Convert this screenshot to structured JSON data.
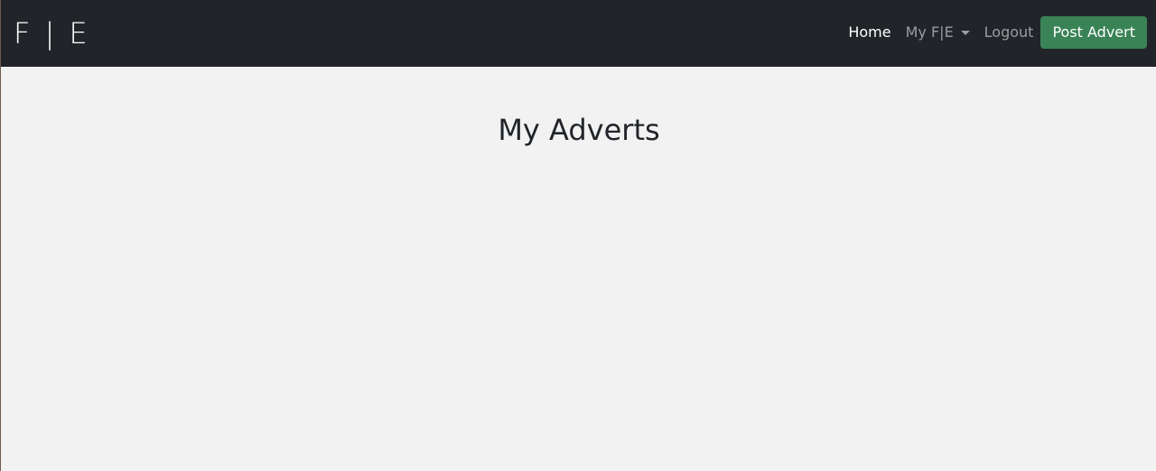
{
  "navbar": {
    "brand": "F | E",
    "links": {
      "home": "Home",
      "my_fe": "My F|E",
      "logout": "Logout"
    },
    "post_button": "Post Advert",
    "colors": {
      "background": "#212529",
      "active_link": "#ffffff",
      "inactive_link": "#9a9da0",
      "button": "#3a8356"
    }
  },
  "main": {
    "title": "My Adverts",
    "background": "#f2f2f2"
  }
}
